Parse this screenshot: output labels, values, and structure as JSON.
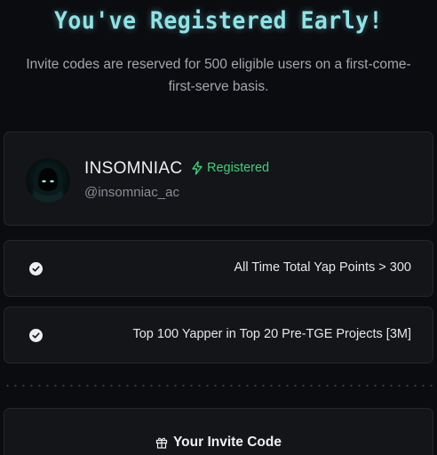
{
  "header": {
    "title": "You've Registered Early!",
    "subtitle": "Invite codes are reserved for 500 eligible users on a first-come-first-serve basis."
  },
  "profile": {
    "name": "INSOMNIAC",
    "status": "Registered",
    "handle": "@insomniac_ac",
    "avatar_icon": "hooded-figure-avatar"
  },
  "requirements": [
    {
      "label": "All Time Total Yap Points > 300",
      "met": true
    },
    {
      "label": "Top 100 Yapper in Top 20 Pre-TGE Projects [3M]",
      "met": true
    }
  ],
  "invite": {
    "title": "Your Invite Code",
    "icon": "gift-icon"
  },
  "colors": {
    "background": "#0b0c0f",
    "card": "#141519",
    "title_accent": "#8fe3e6",
    "status_green": "#3fcf7c"
  }
}
